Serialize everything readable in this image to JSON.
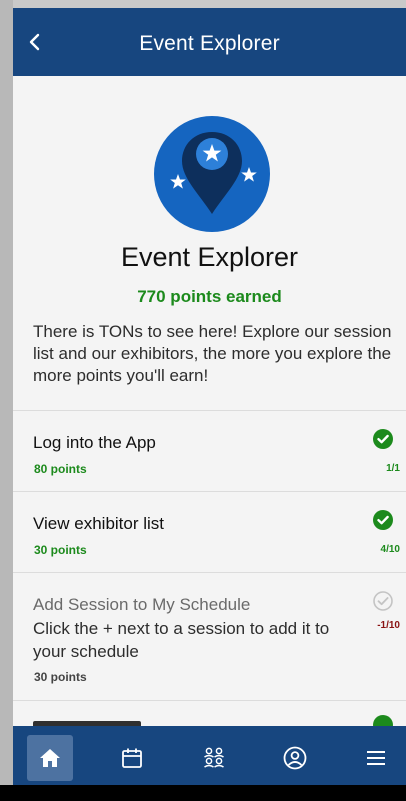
{
  "header": {
    "title": "Event Explorer",
    "back_icon": "chevron-left-icon",
    "color": "#17467f"
  },
  "challenge": {
    "title": "Event Explorer",
    "points_earned": "770 points earned",
    "description": "There is TONs to see here! Explore our session list and our exhibitors, the more you explore the more points you'll earn!",
    "badge_icon": "map-pin-stars-icon",
    "accent_green": "#1c8a1c"
  },
  "tasks": [
    {
      "title": "Log into the App",
      "points": "80 points",
      "progress": "1/1",
      "completed": true
    },
    {
      "title": "View exhibitor list",
      "points": "30 points",
      "progress": "4/10",
      "completed": true
    },
    {
      "title": "Add Session to My Schedule",
      "subtitle": "Click the + next to a session to add it to your schedule",
      "points": "30 points",
      "progress": "-1/10",
      "completed": false
    }
  ],
  "nav": {
    "items": [
      {
        "icon": "home-icon",
        "active": true
      },
      {
        "icon": "calendar-icon",
        "active": false
      },
      {
        "icon": "people-icon",
        "active": false
      },
      {
        "icon": "profile-icon",
        "active": false
      },
      {
        "icon": "menu-icon",
        "active": false
      }
    ]
  }
}
